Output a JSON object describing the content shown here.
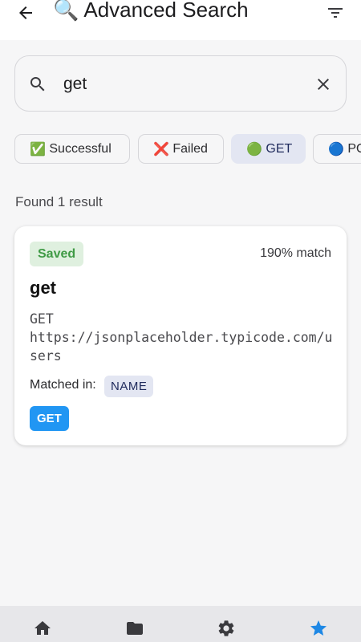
{
  "appbar": {
    "title_emoji": "🔍",
    "title": "Advanced Search",
    "back_icon": "arrow-left-icon",
    "filter_icon": "filter-icon"
  },
  "search": {
    "value": "get",
    "placeholder": "",
    "search_icon": "search-icon",
    "clear_icon": "close-icon"
  },
  "filters": [
    {
      "emoji": "✅",
      "label": "Successful",
      "selected": false
    },
    {
      "emoji": "❌",
      "label": "Failed",
      "selected": false
    },
    {
      "emoji": "🟢",
      "label": "GET",
      "selected": true
    },
    {
      "emoji": "🔵",
      "label": "POST",
      "selected": false
    }
  ],
  "results": {
    "summary": "Found 1 result",
    "items": [
      {
        "badge": "Saved",
        "match": "190% match",
        "name": "get",
        "method_line": "GET",
        "url": "https://jsonplaceholder.typicode.com/users",
        "matched_label": "Matched in:",
        "matched_field": "NAME",
        "method_badge": "GET"
      }
    ]
  },
  "bottom_nav": [
    {
      "icon": "home-icon",
      "active": false
    },
    {
      "icon": "folder-icon",
      "active": false
    },
    {
      "icon": "gear-icon",
      "active": false
    },
    {
      "icon": "star-icon",
      "active": true
    }
  ],
  "colors": {
    "accent": "#2196f3",
    "saved_bg": "#dff0df",
    "saved_text": "#3f9a45",
    "chip_selected": "#e3e6f2"
  }
}
